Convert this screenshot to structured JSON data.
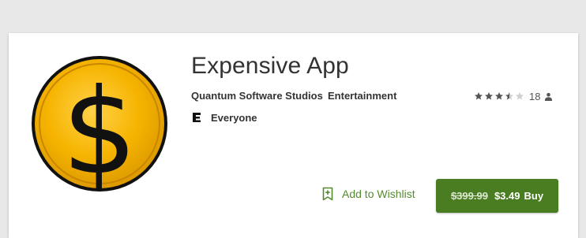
{
  "app": {
    "title": "Expensive App",
    "developer": "Quantum Software Studios",
    "category": "Entertainment",
    "content_rating": "Everyone",
    "rating_stars": 3.5,
    "rating_count": "18"
  },
  "actions": {
    "wishlist_label": "Add to Wishlist",
    "original_price": "$399.99",
    "sale_price": "$3.49",
    "buy_label": "Buy"
  },
  "colors": {
    "accent_green": "#4a7c22",
    "wishlist_green": "#558b2f",
    "coin_gold": "#f6b400"
  },
  "icons": {
    "app_icon": "dollar-coin-icon",
    "content_rating_icon": "esrb-e-icon",
    "rating_person_icon": "person-icon",
    "wishlist_icon": "bookmark-add-icon"
  }
}
